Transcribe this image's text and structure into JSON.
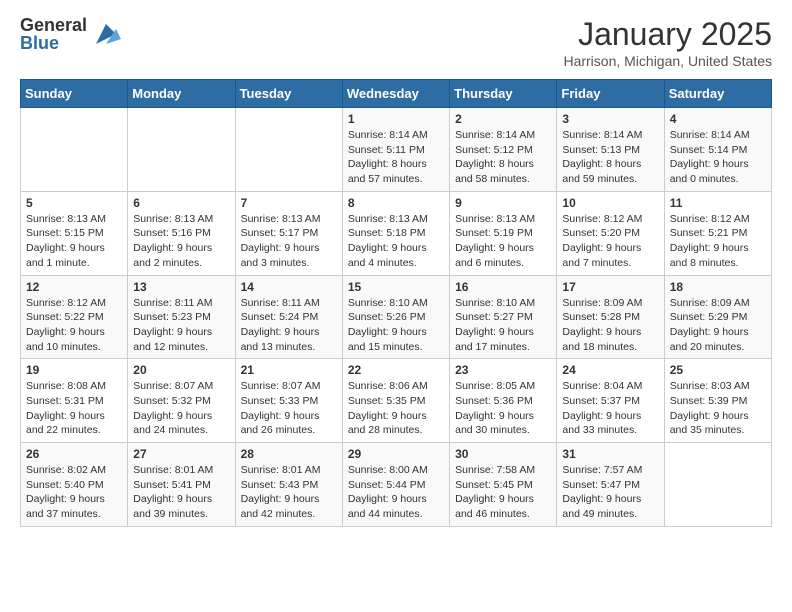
{
  "header": {
    "logo_general": "General",
    "logo_blue": "Blue",
    "month_title": "January 2025",
    "location": "Harrison, Michigan, United States"
  },
  "days_of_week": [
    "Sunday",
    "Monday",
    "Tuesday",
    "Wednesday",
    "Thursday",
    "Friday",
    "Saturday"
  ],
  "weeks": [
    [
      {
        "day": "",
        "content": ""
      },
      {
        "day": "",
        "content": ""
      },
      {
        "day": "",
        "content": ""
      },
      {
        "day": "1",
        "content": "Sunrise: 8:14 AM\nSunset: 5:11 PM\nDaylight: 8 hours and 57 minutes."
      },
      {
        "day": "2",
        "content": "Sunrise: 8:14 AM\nSunset: 5:12 PM\nDaylight: 8 hours and 58 minutes."
      },
      {
        "day": "3",
        "content": "Sunrise: 8:14 AM\nSunset: 5:13 PM\nDaylight: 8 hours and 59 minutes."
      },
      {
        "day": "4",
        "content": "Sunrise: 8:14 AM\nSunset: 5:14 PM\nDaylight: 9 hours and 0 minutes."
      }
    ],
    [
      {
        "day": "5",
        "content": "Sunrise: 8:13 AM\nSunset: 5:15 PM\nDaylight: 9 hours and 1 minute."
      },
      {
        "day": "6",
        "content": "Sunrise: 8:13 AM\nSunset: 5:16 PM\nDaylight: 9 hours and 2 minutes."
      },
      {
        "day": "7",
        "content": "Sunrise: 8:13 AM\nSunset: 5:17 PM\nDaylight: 9 hours and 3 minutes."
      },
      {
        "day": "8",
        "content": "Sunrise: 8:13 AM\nSunset: 5:18 PM\nDaylight: 9 hours and 4 minutes."
      },
      {
        "day": "9",
        "content": "Sunrise: 8:13 AM\nSunset: 5:19 PM\nDaylight: 9 hours and 6 minutes."
      },
      {
        "day": "10",
        "content": "Sunrise: 8:12 AM\nSunset: 5:20 PM\nDaylight: 9 hours and 7 minutes."
      },
      {
        "day": "11",
        "content": "Sunrise: 8:12 AM\nSunset: 5:21 PM\nDaylight: 9 hours and 8 minutes."
      }
    ],
    [
      {
        "day": "12",
        "content": "Sunrise: 8:12 AM\nSunset: 5:22 PM\nDaylight: 9 hours and 10 minutes."
      },
      {
        "day": "13",
        "content": "Sunrise: 8:11 AM\nSunset: 5:23 PM\nDaylight: 9 hours and 12 minutes."
      },
      {
        "day": "14",
        "content": "Sunrise: 8:11 AM\nSunset: 5:24 PM\nDaylight: 9 hours and 13 minutes."
      },
      {
        "day": "15",
        "content": "Sunrise: 8:10 AM\nSunset: 5:26 PM\nDaylight: 9 hours and 15 minutes."
      },
      {
        "day": "16",
        "content": "Sunrise: 8:10 AM\nSunset: 5:27 PM\nDaylight: 9 hours and 17 minutes."
      },
      {
        "day": "17",
        "content": "Sunrise: 8:09 AM\nSunset: 5:28 PM\nDaylight: 9 hours and 18 minutes."
      },
      {
        "day": "18",
        "content": "Sunrise: 8:09 AM\nSunset: 5:29 PM\nDaylight: 9 hours and 20 minutes."
      }
    ],
    [
      {
        "day": "19",
        "content": "Sunrise: 8:08 AM\nSunset: 5:31 PM\nDaylight: 9 hours and 22 minutes."
      },
      {
        "day": "20",
        "content": "Sunrise: 8:07 AM\nSunset: 5:32 PM\nDaylight: 9 hours and 24 minutes."
      },
      {
        "day": "21",
        "content": "Sunrise: 8:07 AM\nSunset: 5:33 PM\nDaylight: 9 hours and 26 minutes."
      },
      {
        "day": "22",
        "content": "Sunrise: 8:06 AM\nSunset: 5:35 PM\nDaylight: 9 hours and 28 minutes."
      },
      {
        "day": "23",
        "content": "Sunrise: 8:05 AM\nSunset: 5:36 PM\nDaylight: 9 hours and 30 minutes."
      },
      {
        "day": "24",
        "content": "Sunrise: 8:04 AM\nSunset: 5:37 PM\nDaylight: 9 hours and 33 minutes."
      },
      {
        "day": "25",
        "content": "Sunrise: 8:03 AM\nSunset: 5:39 PM\nDaylight: 9 hours and 35 minutes."
      }
    ],
    [
      {
        "day": "26",
        "content": "Sunrise: 8:02 AM\nSunset: 5:40 PM\nDaylight: 9 hours and 37 minutes."
      },
      {
        "day": "27",
        "content": "Sunrise: 8:01 AM\nSunset: 5:41 PM\nDaylight: 9 hours and 39 minutes."
      },
      {
        "day": "28",
        "content": "Sunrise: 8:01 AM\nSunset: 5:43 PM\nDaylight: 9 hours and 42 minutes."
      },
      {
        "day": "29",
        "content": "Sunrise: 8:00 AM\nSunset: 5:44 PM\nDaylight: 9 hours and 44 minutes."
      },
      {
        "day": "30",
        "content": "Sunrise: 7:58 AM\nSunset: 5:45 PM\nDaylight: 9 hours and 46 minutes."
      },
      {
        "day": "31",
        "content": "Sunrise: 7:57 AM\nSunset: 5:47 PM\nDaylight: 9 hours and 49 minutes."
      },
      {
        "day": "",
        "content": ""
      }
    ]
  ]
}
